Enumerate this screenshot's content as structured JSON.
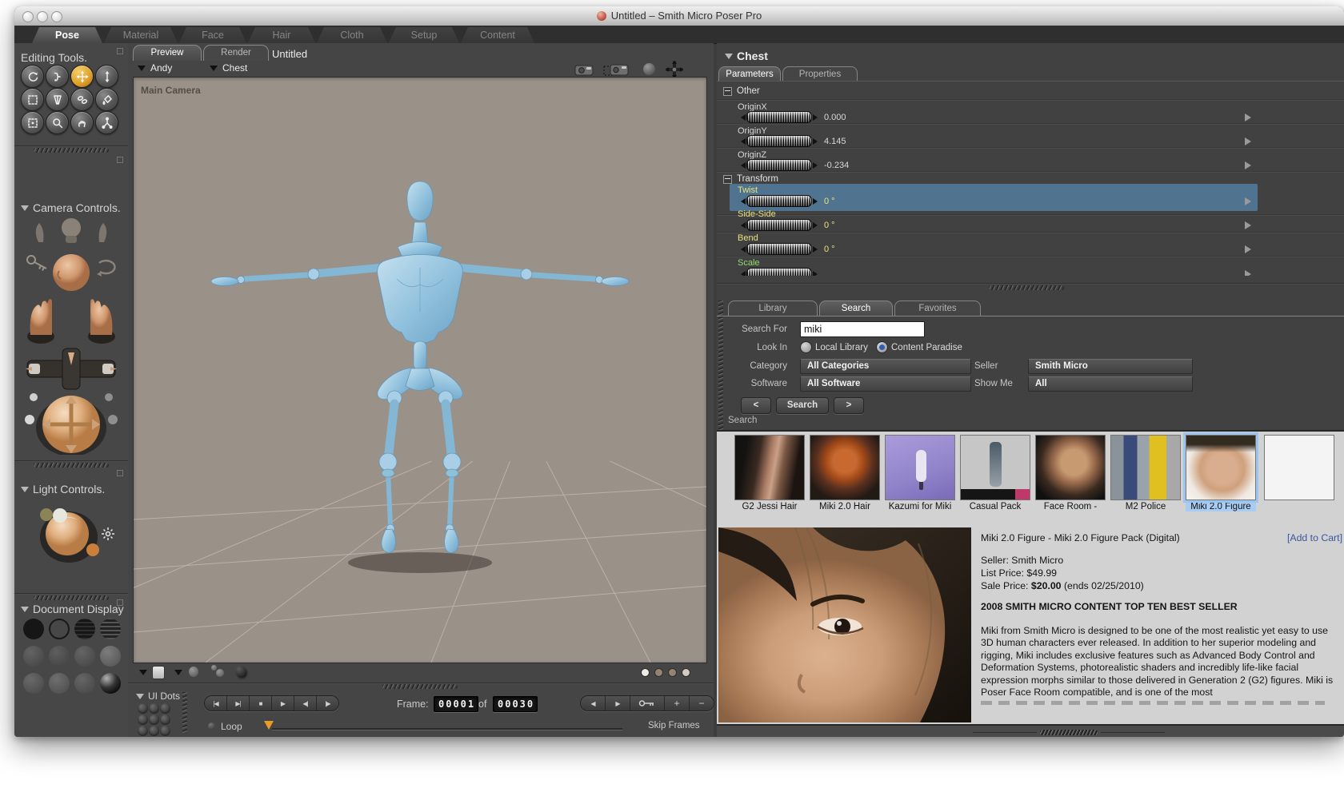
{
  "window": {
    "title": "Untitled – Smith Micro Poser Pro"
  },
  "room_tabs": {
    "active": "Pose",
    "items": [
      {
        "label": "Pose"
      },
      {
        "label": "Material"
      },
      {
        "label": "Face"
      },
      {
        "label": "Hair"
      },
      {
        "label": "Cloth"
      },
      {
        "label": "Setup"
      },
      {
        "label": "Content"
      }
    ]
  },
  "editing_tools": {
    "title": "Editing Tools.",
    "active_tool": "translate-pull",
    "icons": [
      "rotate",
      "twist",
      "translate-pull",
      "translate-in-out",
      "scale",
      "taper",
      "chain-break",
      "color",
      "grouping",
      "view-magnifier",
      "morphing-tool",
      "direct-manipulation"
    ]
  },
  "camera_controls": {
    "title": "Camera Controls."
  },
  "light_controls": {
    "title": "Light Controls."
  },
  "document_display": {
    "title": "Document Display"
  },
  "document": {
    "tabs": [
      "Preview",
      "Render"
    ],
    "active_tab": "Preview",
    "title": "Untitled",
    "figure_menu": "Andy",
    "actor_menu": "Chest",
    "camera_label": "Main Camera",
    "header_icons": [
      "flyaround-camera",
      "select-camera",
      "trackball",
      "move-camera"
    ]
  },
  "timeline": {
    "ui_dots_label": "UI Dots",
    "transport": [
      "|◀",
      "▶|",
      "■",
      "▶",
      "◀|",
      "|▶"
    ],
    "frame_label": "Frame:",
    "frame_current": "00001",
    "of_label": "of",
    "frame_total": "00030",
    "edit_buttons": [
      "◀",
      "▶",
      "key",
      "+",
      "−"
    ],
    "loop_label": "Loop",
    "skip_frames_label": "Skip Frames"
  },
  "parameters_panel": {
    "actor": "Chest",
    "tabs": [
      "Parameters",
      "Properties"
    ],
    "active_tab": "Parameters",
    "groups": [
      {
        "title": "Other",
        "params": [
          {
            "label": "OriginX",
            "value": "0.000"
          },
          {
            "label": "OriginY",
            "value": "4.145"
          },
          {
            "label": "OriginZ",
            "value": "-0.234"
          }
        ]
      },
      {
        "title": "Transform",
        "params": [
          {
            "label": "Twist",
            "value": "0 °",
            "selected": true
          },
          {
            "label": "Side-Side",
            "value": "0 °"
          },
          {
            "label": "Bend",
            "value": "0 °"
          },
          {
            "label": "Scale",
            "value": ""
          }
        ]
      }
    ]
  },
  "library_panel": {
    "tabs": [
      "Library",
      "Search",
      "Favorites"
    ],
    "active_tab": "Search",
    "search_for_label": "Search For",
    "search_value": "miki",
    "look_in_label": "Look In",
    "local_library_label": "Local Library",
    "content_paradise_label": "Content Paradise",
    "content_paradise_checked": true,
    "category_label": "Category",
    "category_value": "All Categories",
    "seller_label": "Seller",
    "seller_value": "Smith Micro",
    "software_label": "Software",
    "software_value": "All Software",
    "show_me_label": "Show Me",
    "show_me_value": "All",
    "prev_button": "<",
    "search_button": "Search",
    "next_button": ">",
    "results_label": "Search",
    "results": [
      {
        "caption": "G2 Jessi Hair"
      },
      {
        "caption": "Miki 2.0 Hair"
      },
      {
        "caption": "Kazumi for Miki"
      },
      {
        "caption": "Casual Pack"
      },
      {
        "caption": "Face Room -"
      },
      {
        "caption": "M2 Police"
      },
      {
        "caption": "Miki 2.0 Figure",
        "selected": true
      }
    ]
  },
  "product": {
    "title": "Miki 2.0 Figure - Miki 2.0 Figure Pack (Digital)",
    "add_to_cart": "[Add to Cart]",
    "seller": "Seller: Smith Micro",
    "list_price": "List Price: $49.99",
    "sale_price_label": "Sale Price:",
    "sale_price_value": "$20.00",
    "sale_price_note": "(ends 02/25/2010)",
    "banner": "2008 SMITH MICRO CONTENT TOP TEN BEST SELLER",
    "description": "Miki from Smith Micro is designed to be one of the most realistic yet easy to use 3D human characters ever released. In addition to her superior modeling and rigging, Miki includes exclusive features such as Advanced Body Control and Deformation Systems, photorealistic shaders and incredibly life-like facial expression morphs similar to those delivered in Generation 2 (G2) figures. Miki is Poser Face Room compatible, and is one of the most"
  },
  "colors": {
    "selection_highlight": "#5483a6",
    "rotation_label": "#e8e27a",
    "scale_label": "#92d96e",
    "accent_orange": "#e8a33d",
    "link_blue": "#3c55a0",
    "thumb_selected": "#a9cdf2",
    "viewport_bg": "#9a9189"
  }
}
